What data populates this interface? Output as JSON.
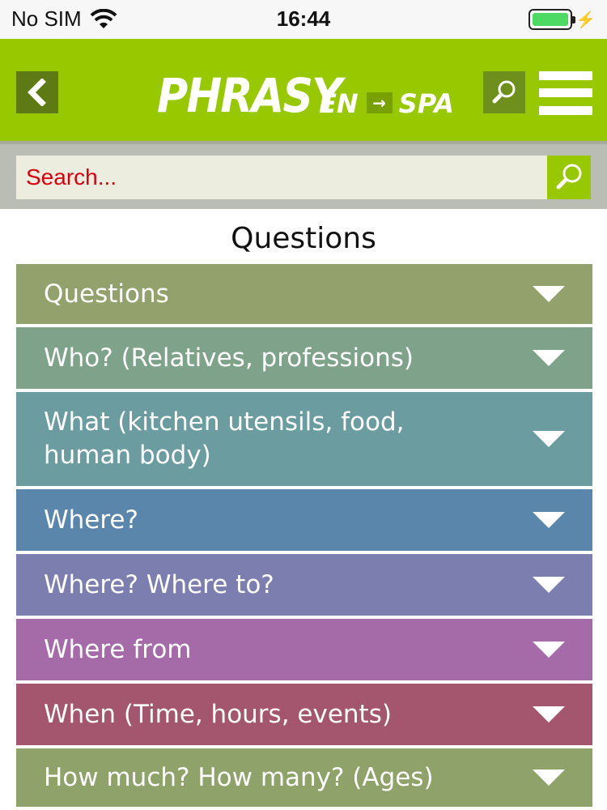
{
  "status_bar": {
    "carrier": "No SIM",
    "time": "16:44"
  },
  "header": {
    "logo_main": "PHRASY",
    "logo_from": "EN",
    "logo_arrow": "→",
    "logo_to": "SPA"
  },
  "search": {
    "placeholder": "Search..."
  },
  "page": {
    "title": "Questions"
  },
  "categories": [
    {
      "label": "Questions",
      "color": "#93a26c"
    },
    {
      "label": "Who? (Relatives, professions)",
      "color": "#7ea28a"
    },
    {
      "label": "What (kitchen utensils, food, human body)",
      "color": "#6a9ca0"
    },
    {
      "label": "Where?",
      "color": "#5b86ac"
    },
    {
      "label": "Where? Where to?",
      "color": "#7c7eb0"
    },
    {
      "label": "Where from",
      "color": "#a56aa8"
    },
    {
      "label": "When (Time, hours, events)",
      "color": "#a3566e"
    },
    {
      "label": "How much? How many? (Ages)",
      "color": "#8ea26a"
    }
  ]
}
